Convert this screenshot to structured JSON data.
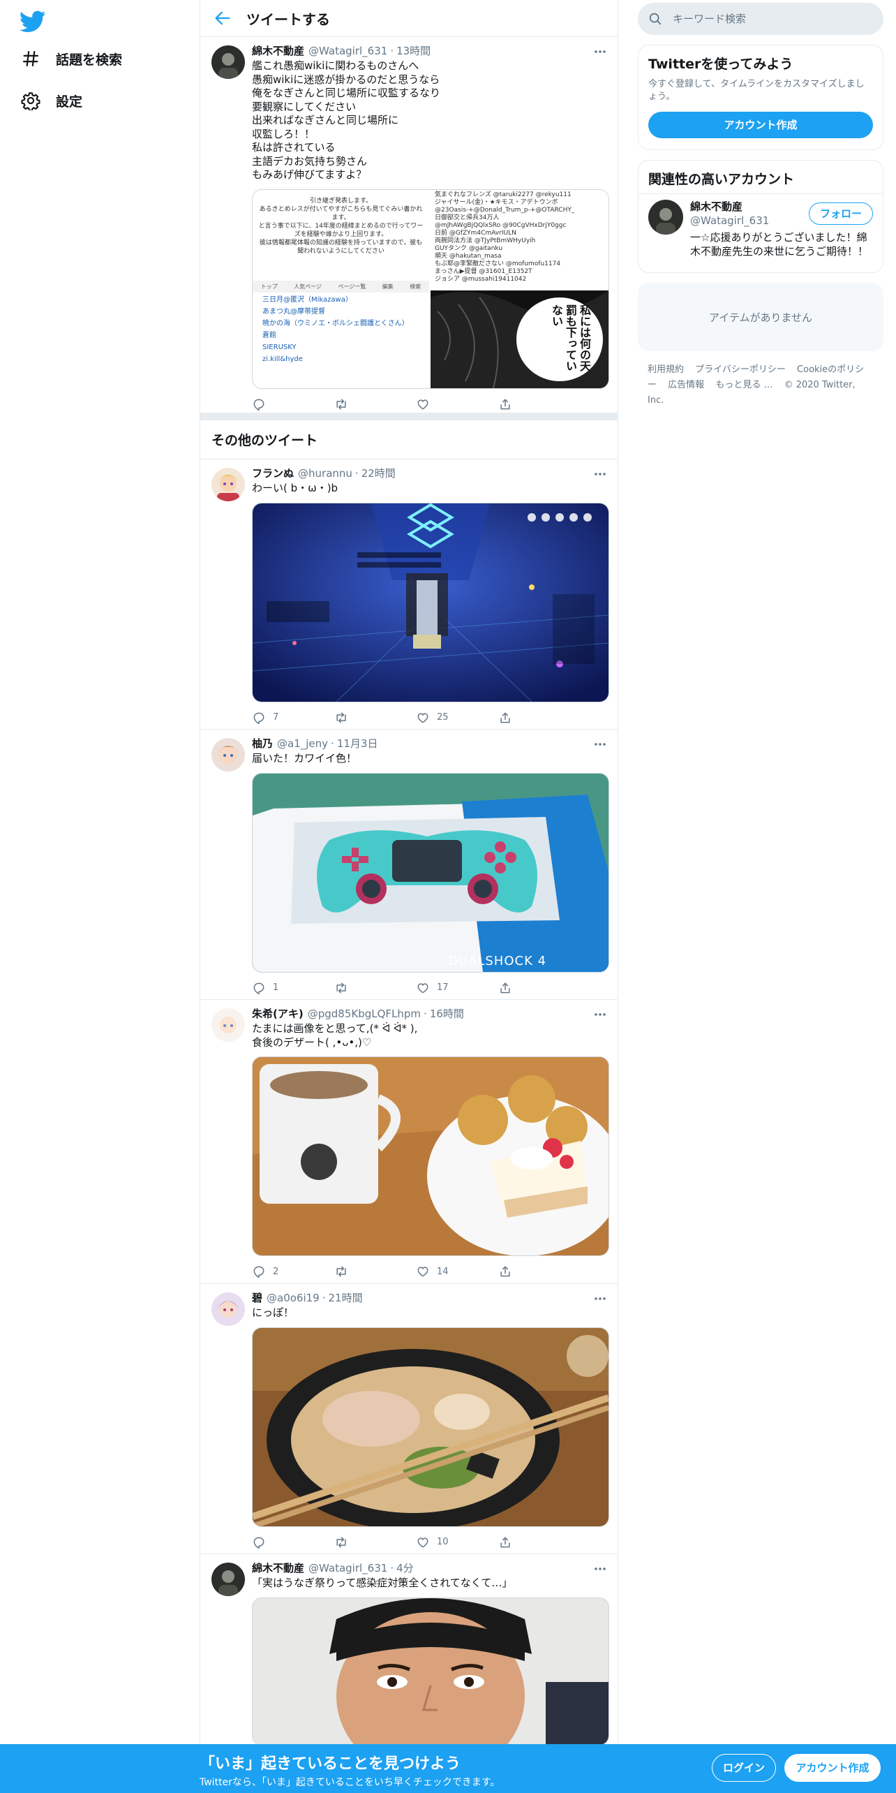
{
  "nav": {
    "explore_label": "話題を検索",
    "settings_label": "設定"
  },
  "header": {
    "title": "ツイートする"
  },
  "main_tweet": {
    "name": "綿木不動産",
    "handle": "@Watagirl_631",
    "time": "13時間",
    "text": "艦これ愚痴wikiに関わるものさんへ\n愚痴wikiに迷惑が掛かるのだと思うなら\n俺をなぎさんと同じ場所に収監するなり\n要観察にしてください\n出来ればなぎさんと同じ場所に\n収監しろ！！\n私は許されている\n主語デカお気持ち勢さん\nもみあげ伸びてますよ？",
    "wiki_text": "引き継ぎ発表します。\nあるきとめレスが付いてやすがこちらも見てぐみい書かれます。\nと言う事で以下に、14年度の経緯まとめるので行ってワーズを経験や誰かより上回ります。\n彼は情報都尾体報の知識の経験を持っていますので，彼も聞われないようにしてください",
    "wiki_toolbar": [
      "トップ",
      "人気ページ",
      "ページ一覧",
      "編集",
      "検索"
    ],
    "wiki_list": [
      "三日月@匿沢（Mikazawa）",
      "あまつ丸@摩帯提督",
      "暁かの海（ウミノエ・ボルシェ闘護とくさん）",
      "蒼館",
      "SIERUSKY",
      "zi.kill&hyde"
    ],
    "quote_text": "気まぐれなフレンズ @taruki2277 @rekyu111\nジャイサール(金)・★キモス・アデトウンボ\n@23Oasis-+@Donald_Trum_p-+@OTARCHY_\n日御部交と帰兵34万人\n@mJhAWgBjQQlxSRo @90CgVHxDrjY0ggc\n日前 @GfZYm4CmAvrIULN\n両腕同法方法 @TJyPtBmWHyUyih\nGUYタンク @gaitanku\n順天 @hakutan_masa\nもぶ耶@李緊敵ださない @mofumofu1174\nまっさん▶提督 @31601_E1352T\nジョシア @mussahi19411042",
    "manga_text": "私には何の天罰も下っていない"
  },
  "other_tweets_title": "その他のツイート",
  "tweets": [
    {
      "name": "フランぬ",
      "handle": "@hurannu",
      "time": "22時間",
      "text": "わーい( b・ω・)b",
      "replies": "7",
      "retweets": "",
      "likes": "25"
    },
    {
      "name": "柚乃",
      "handle": "@a1_jeny",
      "time": "11月3日",
      "text": "届いた！カワイイ色！",
      "replies": "1",
      "retweets": "",
      "likes": "17",
      "controller_label": "DUALSHOCK 4"
    },
    {
      "name": "朱希(アキ)",
      "handle": "@pgd85KbgLQFLhpm",
      "time": "16時間",
      "text": "たまには画像をと思って,(* ᐛ ᐛ* ),\n食後のデザート( ,•ᴗ•,)♡",
      "replies": "2",
      "retweets": "",
      "likes": "14"
    },
    {
      "name": "碧",
      "handle": "@a0o6i19",
      "time": "21時間",
      "text": "にっぽ！",
      "replies": "",
      "retweets": "",
      "likes": "10"
    },
    {
      "name": "綿木不動産",
      "handle": "@Watagirl_631",
      "time": "4分",
      "text": "「実はうなぎ祭りって感染症対策全くされてなくて…」",
      "replies": "",
      "retweets": "",
      "likes": ""
    }
  ],
  "search": {
    "placeholder": "キーワード検索"
  },
  "signup_card": {
    "title": "Twitterを使ってみよう",
    "desc": "今すぐ登録して、タイムラインをカスタマイズしましょう。",
    "button": "アカウント作成"
  },
  "relevant_card": {
    "title": "関連性の高いアカウント",
    "name": "綿木不動産",
    "handle": "@Watagirl_631",
    "bio": "一☆応援ありがとうございました！綿木不動産先生の来世に乞うご期待！！",
    "follow": "フォロー"
  },
  "empty_card": {
    "text": "アイテムがありません"
  },
  "footer": {
    "terms": "利用規約",
    "privacy": "プライバシーポリシー",
    "cookie": "Cookieのポリシー",
    "ads": "広告情報",
    "more": "もっと見る …",
    "copyright": "© 2020 Twitter, Inc."
  },
  "bottom_bar": {
    "title": "「いま」起きていることを見つけよう",
    "subtitle": "Twitterなら、「いま」起きていることをいち早くチェックできます。",
    "login": "ログイン",
    "signup": "アカウント作成"
  },
  "colors": {
    "accent": "#1da1f2",
    "text": "#14171a",
    "muted": "#657786",
    "border": "#e6ecf0"
  },
  "icons": [
    "twitter-logo-icon",
    "hashtag-icon",
    "gear-icon",
    "back-arrow-icon",
    "more-icon",
    "reply-icon",
    "retweet-icon",
    "like-icon",
    "share-icon",
    "search-icon"
  ]
}
